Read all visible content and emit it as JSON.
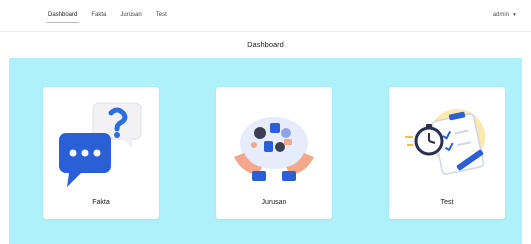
{
  "nav": {
    "links": [
      "Dashboard",
      "Fakta",
      "Jurusan",
      "Test"
    ],
    "active_index": 0,
    "user": "admin",
    "user_icon": "chevron-down-icon"
  },
  "page": {
    "title": "Dashboard"
  },
  "colors": {
    "panel_bg": "#aef1fb",
    "card_bg": "#ffffff",
    "accent_blue": "#2a5fd6"
  },
  "cards": [
    {
      "label": "Fakta",
      "icon": "chat-question-icon"
    },
    {
      "label": "Jurusan",
      "icon": "hands-school-icon"
    },
    {
      "label": "Test",
      "icon": "clipboard-stopwatch-icon"
    }
  ]
}
